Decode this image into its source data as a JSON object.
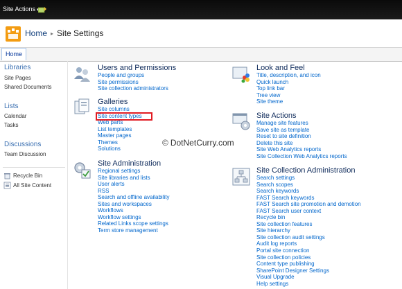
{
  "topbar": {
    "site_actions_label": "Site Actions"
  },
  "breadcrumb": {
    "home": "Home",
    "separator": "▸",
    "current": "Site Settings"
  },
  "tabs": [
    {
      "label": "Home"
    }
  ],
  "left_nav": {
    "libraries": {
      "heading": "Libraries",
      "items": [
        "Site Pages",
        "Shared Documents"
      ]
    },
    "lists": {
      "heading": "Lists",
      "items": [
        "Calendar",
        "Tasks"
      ]
    },
    "discussions": {
      "heading": "Discussions",
      "items": [
        "Team Discussion"
      ]
    },
    "footer_items": [
      "Recycle Bin",
      "All Site Content"
    ]
  },
  "sections": {
    "users": {
      "title": "Users and Permissions",
      "icon": "users-icon",
      "links": [
        "People and groups",
        "Site permissions",
        "Site collection administrators"
      ]
    },
    "galleries": {
      "title": "Galleries",
      "icon": "galleries-icon",
      "links": [
        "Site columns",
        "Site content types",
        "Web parts",
        "List templates",
        "Master pages",
        "Themes",
        "Solutions"
      ]
    },
    "site_admin": {
      "title": "Site Administration",
      "icon": "site-admin-icon",
      "links": [
        "Regional settings",
        "Site libraries and lists",
        "User alerts",
        "RSS",
        "Search and offline availability",
        "Sites and workspaces",
        "Workflows",
        "Workflow settings",
        "Related Links scope settings",
        "Term store management"
      ]
    },
    "look_feel": {
      "title": "Look and Feel",
      "icon": "look-feel-icon",
      "links": [
        "Title, description, and icon",
        "Quick launch",
        "Top link bar",
        "Tree view",
        "Site theme"
      ]
    },
    "site_actions": {
      "title": "Site Actions",
      "icon": "site-actions-icon",
      "links": [
        "Manage site features",
        "Save site as template",
        "Reset to site definition",
        "Delete this site",
        "Site Web Analytics reports",
        "Site Collection Web Analytics reports"
      ]
    },
    "site_collection_admin": {
      "title": "Site Collection Administration",
      "icon": "site-collection-admin-icon",
      "links": [
        "Search settings",
        "Search scopes",
        "Search keywords",
        "FAST Search keywords",
        "FAST Search site promotion and demotion",
        "FAST Search user context",
        "Recycle bin",
        "Site collection features",
        "Site hierarchy",
        "Site collection audit settings",
        "Audit log reports",
        "Portal site connection",
        "Site collection policies",
        "Content type publishing",
        "SharePoint Designer Settings",
        "Visual Upgrade",
        "Help settings"
      ]
    }
  },
  "watermark": {
    "symbol": "©",
    "text": "DotNetCurry.com"
  },
  "colors": {
    "link": "#0066cc",
    "highlight_box": "#e11b22",
    "topbar": "#111111",
    "logo": "#f39c12"
  }
}
